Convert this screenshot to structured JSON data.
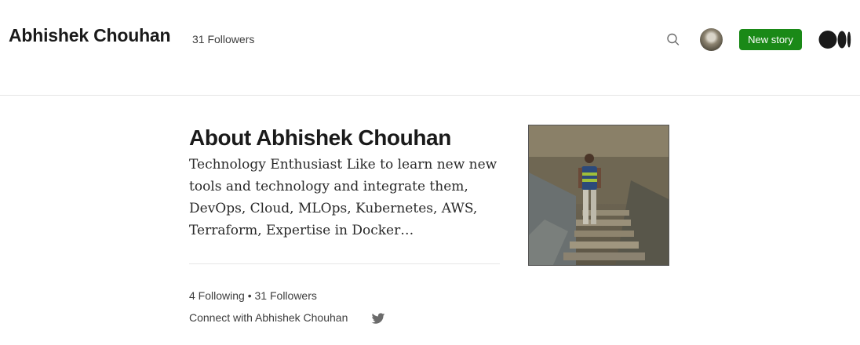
{
  "header": {
    "site_name": "Abhishek Chouhan",
    "follower_count": "31 Followers",
    "new_story_label": "New story"
  },
  "about": {
    "title": "About Abhishek Chouhan",
    "bio": "Technology Enthusiast Like to learn new new tools and technology and integrate them, DevOps, Cloud, MLOps, Kubernetes, AWS, Terraform, Expertise in Docker…"
  },
  "stats": {
    "following": "4 Following",
    "separator": " • ",
    "followers": "31 Followers"
  },
  "connect": {
    "label": "Connect with Abhishek Chouhan"
  },
  "colors": {
    "accent_green": "#1a8917",
    "text_dark": "#292929",
    "twitter_grey": "#6b6b6b"
  },
  "icons": [
    "search-icon",
    "avatar",
    "medium-logo-icon",
    "twitter-icon"
  ]
}
